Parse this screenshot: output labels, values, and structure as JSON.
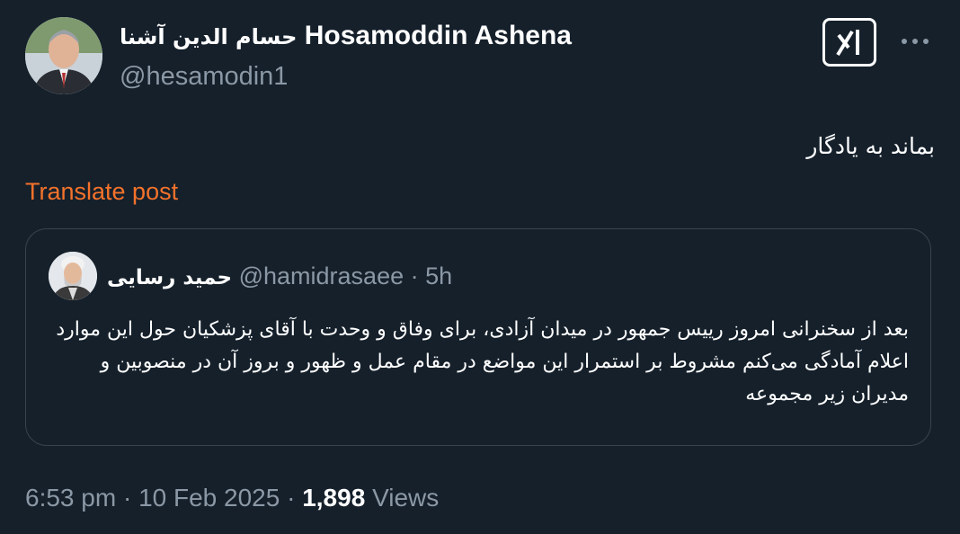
{
  "author": {
    "name_fa": "حسام الدين آشنا",
    "name_en": "Hosamoddin Ashena",
    "handle": "@hesamodin1"
  },
  "post": {
    "text": "بماند به يادگار",
    "translate_label": "Translate post"
  },
  "quoted": {
    "name": "حميد رسايى",
    "handle": "@hamidrasaee",
    "separator": "·",
    "time": "5h",
    "text": "بعد از سخنرانی امروز رییس جمهور در میدان آزادی، برای وفاق و وحدت با آقای پزشکیان حول این موارد اعلام آمادگی می‌کنم مشروط بر استمرار این مواضع در مقام عمل و ظهور و بروز آن در منصوبین و مدیران زیر مجموعه"
  },
  "meta": {
    "time": "6:53 pm",
    "separator": "·",
    "date": "10 Feb 2025",
    "separator2": "·",
    "views_count": "1,898",
    "views_label": "Views"
  },
  "icons": {
    "grok": "grok-icon",
    "more": "more-icon"
  },
  "colors": {
    "background": "#15202b",
    "secondary_text": "#8b98a5",
    "translate_link": "#f4722b",
    "border": "#38444d"
  }
}
